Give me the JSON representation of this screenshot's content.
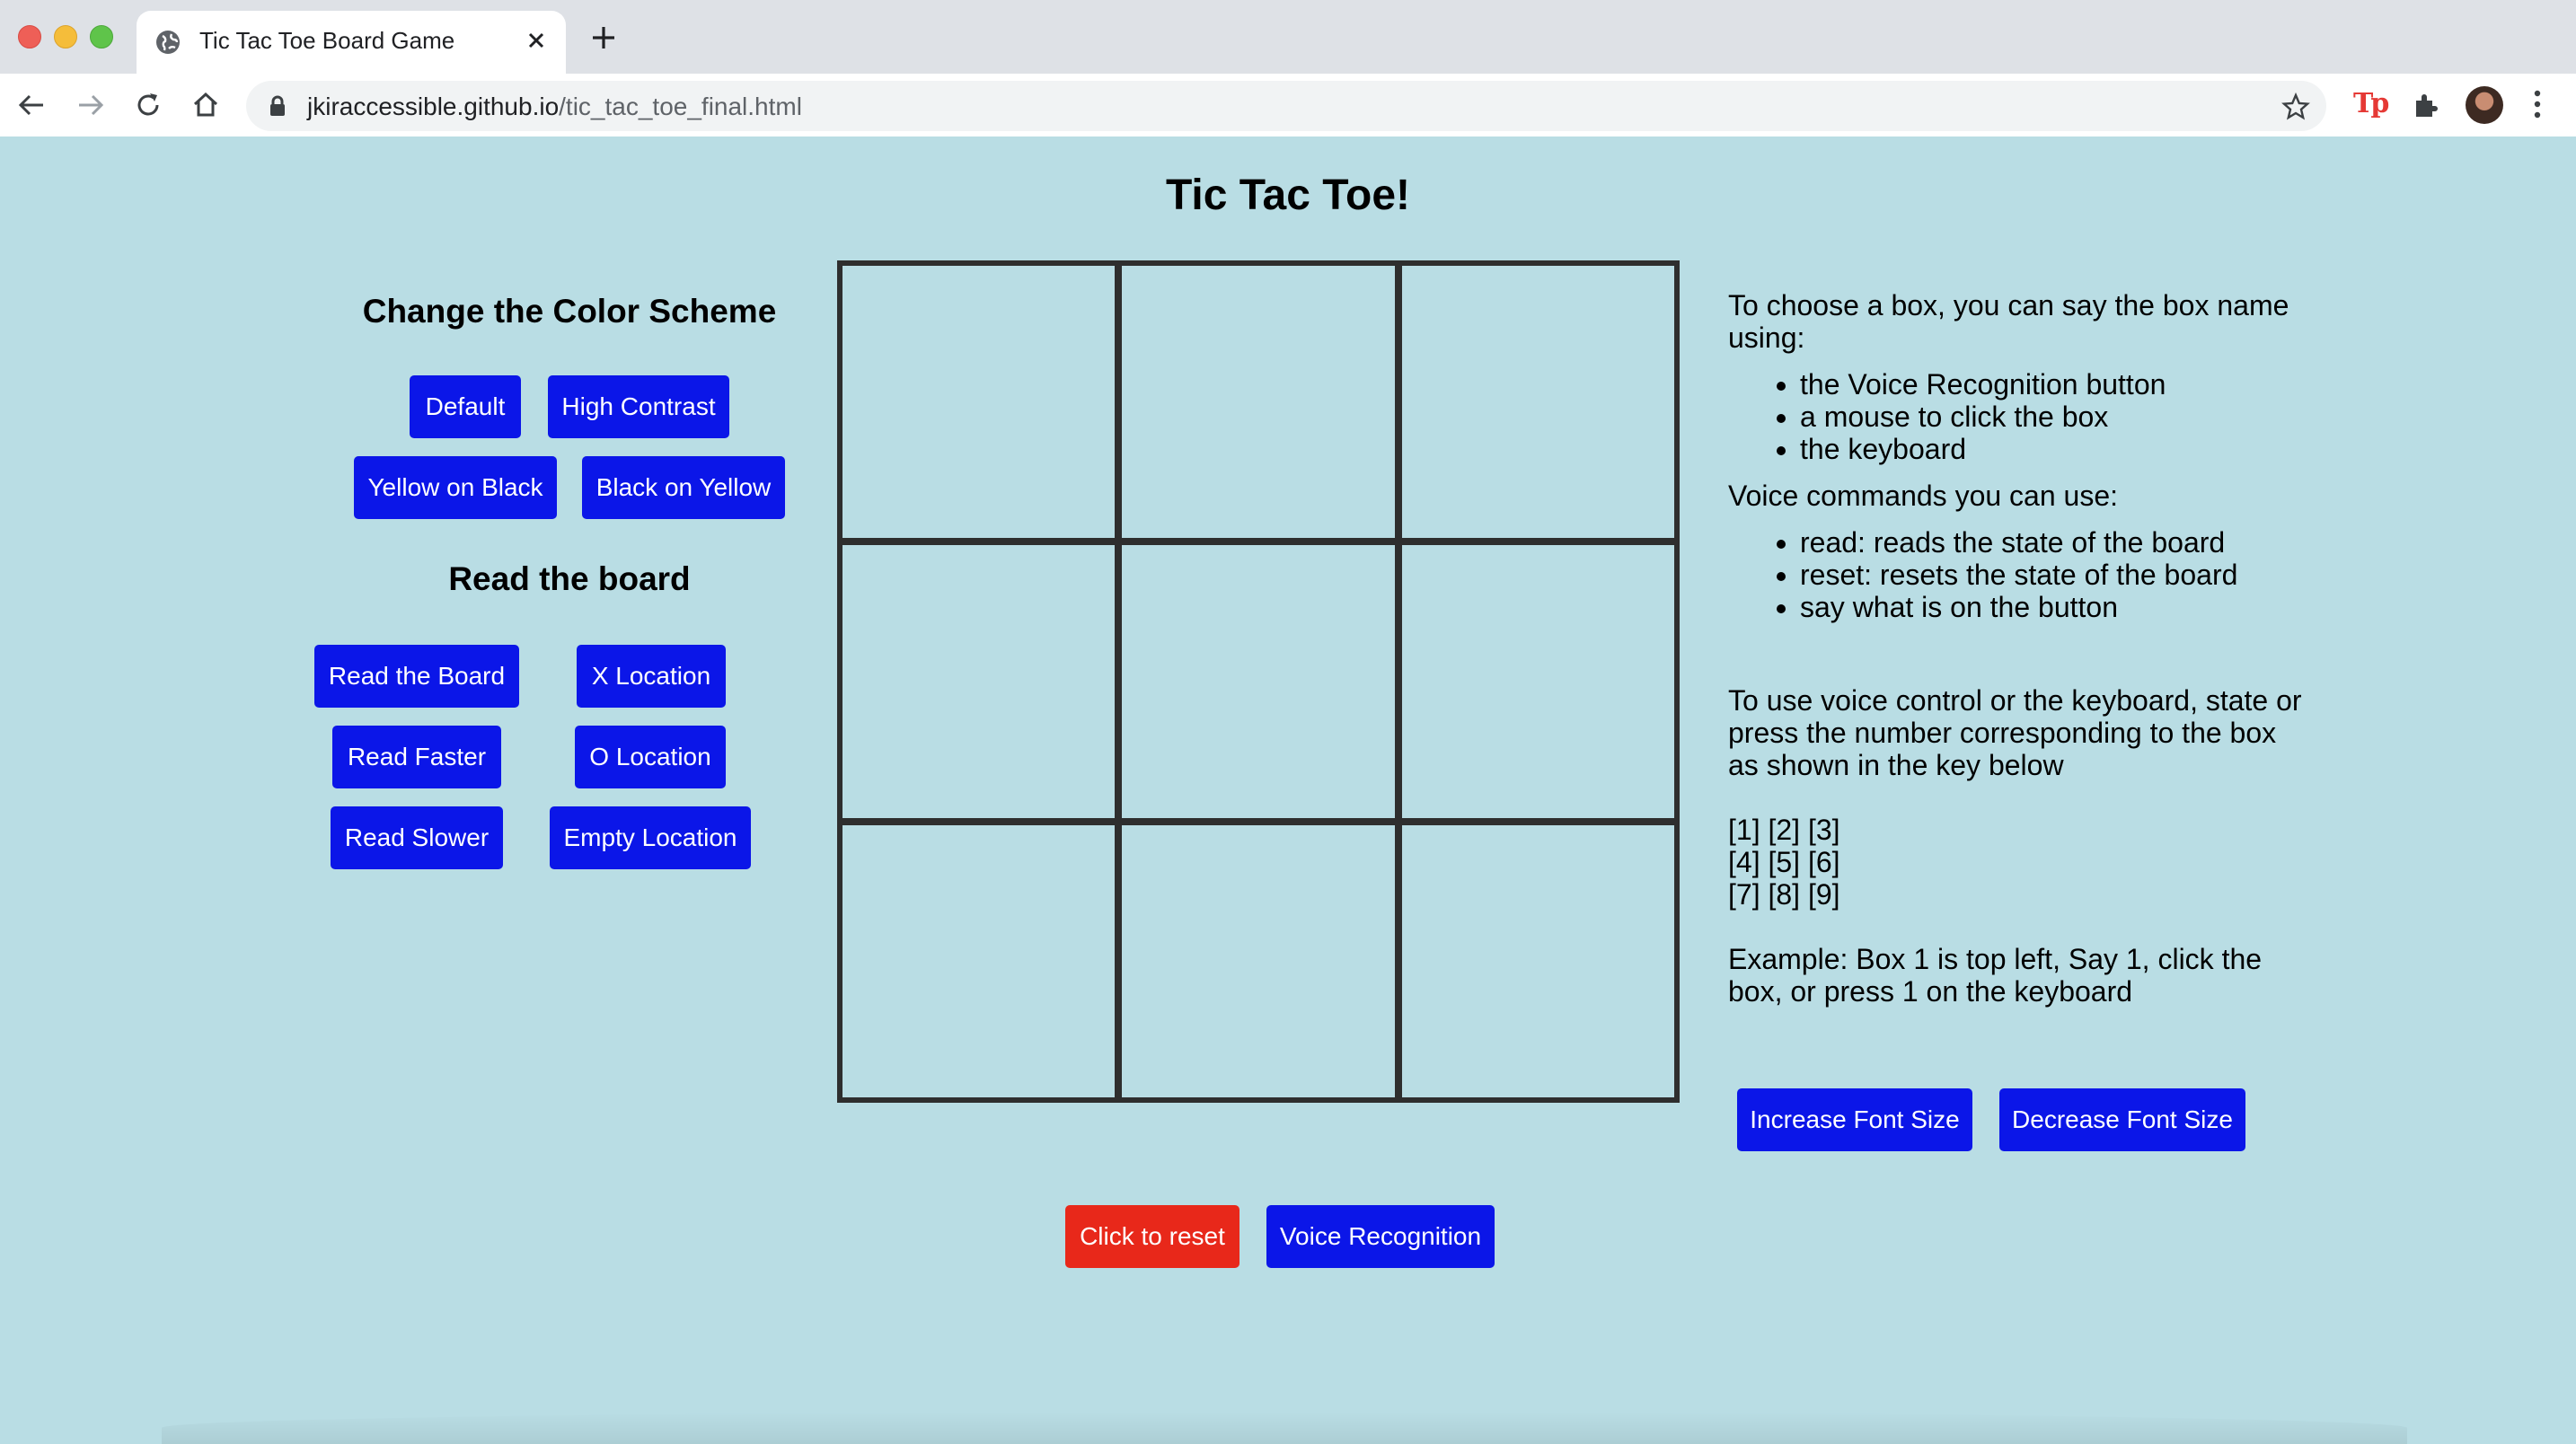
{
  "browser": {
    "tab_title": "Tic Tac Toe Board Game",
    "url_domain": "jkiraccessible.github.io",
    "url_path": "/tic_tac_toe_final.html",
    "extension_label": "Tp"
  },
  "page": {
    "title": "Tic Tac Toe!",
    "color_scheme": {
      "heading": "Change the Color Scheme",
      "buttons": [
        "Default",
        "High Contrast",
        "Yellow on Black",
        "Black on Yellow"
      ]
    },
    "read_board": {
      "heading": "Read the board",
      "buttons": [
        "Read the Board",
        "X Location",
        "Read Faster",
        "O Location",
        "Read Slower",
        "Empty Location"
      ]
    },
    "board": {
      "cells": [
        "",
        "",
        "",
        "",
        "",
        "",
        "",
        "",
        ""
      ]
    },
    "instructions": {
      "intro": "To choose a box, you can say the box name using:",
      "methods": [
        "the Voice Recognition button",
        "a mouse to click the box",
        "the keyboard"
      ],
      "commands_intro": "Voice commands you can use:",
      "commands": [
        "read: reads the state of the board",
        "reset: resets the state of the board",
        "say what is on the button"
      ],
      "keyboard_note": "To use voice control or the keyboard, state or press the number corresponding to the box as shown in the key below",
      "key_rows": [
        "[1] [2] [3]",
        "[4] [5] [6]",
        "[7] [8] [9]"
      ],
      "example": "Example: Box 1 is top left, Say 1, click the box, or press 1 on the keyboard"
    },
    "font_buttons": {
      "increase": "Increase Font Size",
      "decrease": "Decrease Font Size"
    },
    "bottom_buttons": {
      "reset": "Click to reset",
      "voice": "Voice Recognition"
    },
    "colors": {
      "background": "#b9dde4",
      "button": "#0b16e8",
      "reset_button": "#e8281a",
      "grid_line": "#2e2e2e"
    }
  }
}
